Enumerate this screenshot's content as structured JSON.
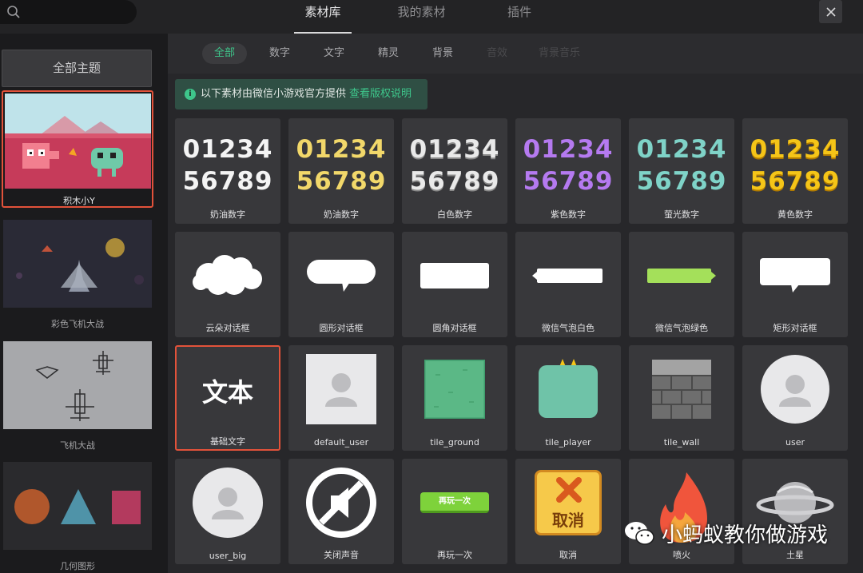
{
  "search": {
    "placeholder": ""
  },
  "tabs": [
    {
      "label": "素材库",
      "active": true
    },
    {
      "label": "我的素材",
      "active": false
    },
    {
      "label": "插件",
      "active": false
    }
  ],
  "sidebar": {
    "all_themes_label": "全部主题",
    "themes": [
      {
        "label": "积木小Y",
        "selected": true
      },
      {
        "label": "彩色飞机大战",
        "selected": false
      },
      {
        "label": "飞机大战",
        "selected": false
      },
      {
        "label": "几何图形",
        "selected": false
      }
    ]
  },
  "filters": [
    {
      "label": "全部",
      "state": "active"
    },
    {
      "label": "数字",
      "state": "normal"
    },
    {
      "label": "文字",
      "state": "normal"
    },
    {
      "label": "精灵",
      "state": "normal"
    },
    {
      "label": "背景",
      "state": "normal"
    },
    {
      "label": "音效",
      "state": "disabled"
    },
    {
      "label": "背景音乐",
      "state": "disabled"
    }
  ],
  "notice": {
    "icon": "info-icon",
    "text": "以下素材由微信小游戏官方提供",
    "link": "查看版权说明"
  },
  "digits_text": {
    "line1": "01234",
    "line2": "56789"
  },
  "text_sample": "文本",
  "replay_button_text": "再玩一次",
  "cancel_button_text": "取消",
  "assets": [
    {
      "label": "奶油数字",
      "icon": "cream-digits-white",
      "color": "#f4f4f4"
    },
    {
      "label": "奶油数字",
      "icon": "cream-digits-yellow",
      "color": "#f2d86a"
    },
    {
      "label": "白色数字",
      "icon": "white-digits",
      "color": "#e9e9e9"
    },
    {
      "label": "紫色数字",
      "icon": "purple-digits",
      "color": "#b57af0"
    },
    {
      "label": "萤光数字",
      "icon": "fluorescent-digits",
      "color": "#7fd3c8"
    },
    {
      "label": "黄色数字",
      "icon": "yellow-digits",
      "color": "#f5c518"
    },
    {
      "label": "云朵对话框",
      "icon": "cloud-bubble"
    },
    {
      "label": "圆形对话框",
      "icon": "round-bubble"
    },
    {
      "label": "圆角对话框",
      "icon": "rounded-rect-bubble"
    },
    {
      "label": "微信气泡白色",
      "icon": "wechat-bubble-white",
      "color": "#ffffff"
    },
    {
      "label": "微信气泡绿色",
      "icon": "wechat-bubble-green",
      "color": "#a4e05a"
    },
    {
      "label": "矩形对话框",
      "icon": "rect-bubble"
    },
    {
      "label": "基础文字",
      "icon": "basic-text",
      "selected": true
    },
    {
      "label": "default_user",
      "icon": "default-user-avatar"
    },
    {
      "label": "tile_ground",
      "icon": "tile-ground",
      "color": "#5bb886"
    },
    {
      "label": "tile_player",
      "icon": "tile-player",
      "color": "#6fc3a8"
    },
    {
      "label": "tile_wall",
      "icon": "tile-wall",
      "color": "#6e6e6e"
    },
    {
      "label": "user",
      "icon": "user-avatar-circle"
    },
    {
      "label": "user_big",
      "icon": "user-big-avatar"
    },
    {
      "label": "关闭声音",
      "icon": "mute-sound"
    },
    {
      "label": "再玩一次",
      "icon": "replay-button",
      "color": "#7ed23b"
    },
    {
      "label": "取消",
      "icon": "cancel-button",
      "color": "#f6c94a"
    },
    {
      "label": "喷火",
      "icon": "fire"
    },
    {
      "label": "土星",
      "icon": "saturn"
    }
  ],
  "watermark": {
    "icon": "wechat-icon",
    "text": "小蚂蚁教你做游戏"
  },
  "colors": {
    "accent": "#3ec68b",
    "selection": "#e2523a"
  }
}
